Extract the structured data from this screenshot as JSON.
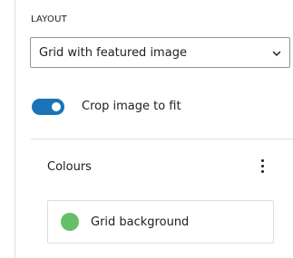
{
  "layout_section": {
    "label": "LAYOUT",
    "select": {
      "value": "Grid with featured image",
      "icon": "chevron-down-icon"
    }
  },
  "crop_toggle": {
    "label": "Crop image to fit",
    "checked": true,
    "color": "#1a73b8"
  },
  "colours": {
    "heading": "Colours",
    "menu_icon": "kebab-menu-icon",
    "items": [
      {
        "label": "Grid background",
        "swatch_color": "#65bf69"
      }
    ]
  }
}
